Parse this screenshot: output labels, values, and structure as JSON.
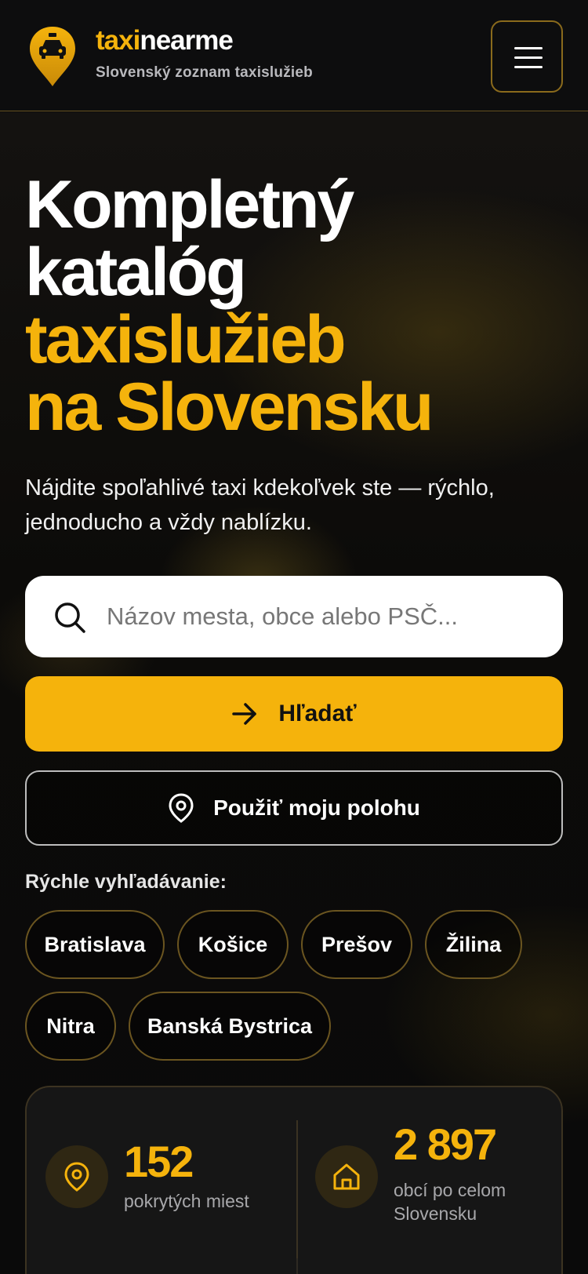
{
  "header": {
    "brand_part1": "taxi",
    "brand_part2": "nearme",
    "tagline": "Slovenský zoznam taxislužieb"
  },
  "hero": {
    "title_line1": "Kompletný",
    "title_line2": "katalóg",
    "title_line3": "taxislužieb",
    "title_line4": "na Slovensku",
    "lead": "Nájdite spoľahlivé taxi kdekoľvek ste — rýchlo, jednoducho a vždy nablízku."
  },
  "search": {
    "placeholder": "Názov mesta, obce alebo PSČ..."
  },
  "buttons": {
    "search_label": "Hľadať",
    "location_label": "Použiť moju polohu"
  },
  "quick": {
    "label": "Rýchle vyhľadávanie:",
    "cities": [
      "Bratislava",
      "Košice",
      "Prešov",
      "Žilina",
      "Nitra",
      "Banská Bystrica"
    ]
  },
  "stats": {
    "cities_count": "152",
    "cities_label": "pokrytých miest",
    "villages_count": "2 897",
    "villages_label": "obcí po celom Slovensku"
  },
  "colors": {
    "accent": "#f5b30c",
    "background": "#0b0b0c",
    "card": "#161616"
  }
}
